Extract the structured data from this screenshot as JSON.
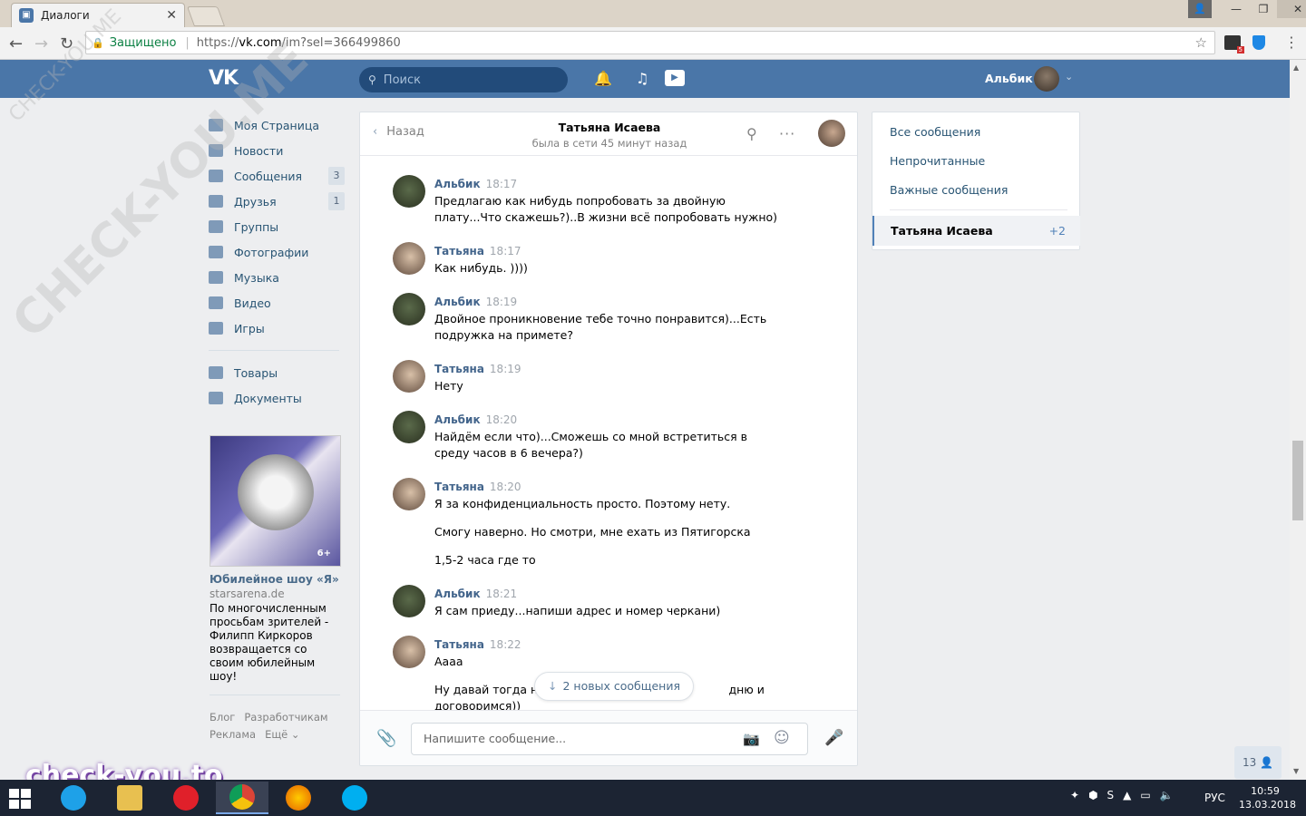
{
  "browser": {
    "tab_title": "Диалоги",
    "close_glyph": "✕",
    "secure_label": "Защищено",
    "url_scheme": "https://",
    "url_host": "vk.com",
    "url_path": "/im?sel=366499860",
    "ext_badge": "5"
  },
  "vk_header": {
    "logo": "VK",
    "search_placeholder": "Поиск",
    "user_name": "Альбик"
  },
  "left_menu": {
    "items": [
      {
        "label": "Моя Страница",
        "icon": "home-icon"
      },
      {
        "label": "Новости",
        "icon": "news-icon"
      },
      {
        "label": "Сообщения",
        "icon": "messages-icon",
        "count": "3"
      },
      {
        "label": "Друзья",
        "icon": "friends-icon",
        "count": "1"
      },
      {
        "label": "Группы",
        "icon": "groups-icon"
      },
      {
        "label": "Фотографии",
        "icon": "camera-icon"
      },
      {
        "label": "Музыка",
        "icon": "music-icon"
      },
      {
        "label": "Видео",
        "icon": "video-icon"
      },
      {
        "label": "Игры",
        "icon": "gamepad-icon"
      }
    ],
    "secondary": [
      {
        "label": "Товары",
        "icon": "bag-icon"
      },
      {
        "label": "Документы",
        "icon": "document-icon"
      }
    ]
  },
  "ad": {
    "title": "Юбилейное шоу «Я»",
    "site": "starsarena.de",
    "description": "По многочисленным просьбам зрителей - Филипп Киркоров возвращается со своим юбилейным шоу!",
    "age": "6+"
  },
  "footer": {
    "blog": "Блог",
    "developers": "Разработчикам",
    "ads": "Реклама",
    "more": "Ещё ⌄"
  },
  "chat": {
    "back_label": "Назад",
    "name": "Татьяна Исаева",
    "status": "была в сети 45 минут назад",
    "messages": [
      {
        "author": "Альбик",
        "time": "18:17",
        "lines": [
          "Предлагаю как нибудь попробовать за двойную плату...Что скажешь?)..В жизни всё попробовать нужно)"
        ]
      },
      {
        "author": "Татьяна",
        "time": "18:17",
        "lines": [
          "Как нибудь. ))))"
        ]
      },
      {
        "author": "Альбик",
        "time": "18:19",
        "lines": [
          "Двойное проникновение тебе точно понравится)...Есть подружка на примете?"
        ]
      },
      {
        "author": "Татьяна",
        "time": "18:19",
        "lines": [
          "Нету"
        ]
      },
      {
        "author": "Альбик",
        "time": "18:20",
        "lines": [
          "Найдём если что)...Сможешь со мной встретиться в среду часов в 6 вечера?)"
        ]
      },
      {
        "author": "Татьяна",
        "time": "18:20",
        "lines": [
          "Я за конфиденциальность просто. Поэтому нету.",
          "Смогу наверно. Но смотри, мне ехать из Пятигорска",
          "1,5-2 часа где то"
        ]
      },
      {
        "author": "Альбик",
        "time": "18:21",
        "lines": [
          "Я сам приеду...напиши адрес и номер черкани)"
        ]
      },
      {
        "author": "Татьяна",
        "time": "18:22",
        "lines": [
          "Аааа",
          "Ну давай тогда на                                                   дню и договоримся))"
        ]
      }
    ],
    "new_messages_label": "2 новых сообщения",
    "input_placeholder": "Напишите сообщение..."
  },
  "right_panel": {
    "all": "Все сообщения",
    "unread": "Непрочитанные",
    "important": "Важные сообщения",
    "active_name": "Татьяна Исаева",
    "active_count": "+2"
  },
  "friends_online": "13",
  "watermark": {
    "big": "CHECK-YOU.ME",
    "small": "CHECK-YOU.ME",
    "bottom": "check-you.to"
  },
  "taskbar": {
    "lang": "РУС",
    "time": "10:59",
    "date": "13.03.2018"
  }
}
